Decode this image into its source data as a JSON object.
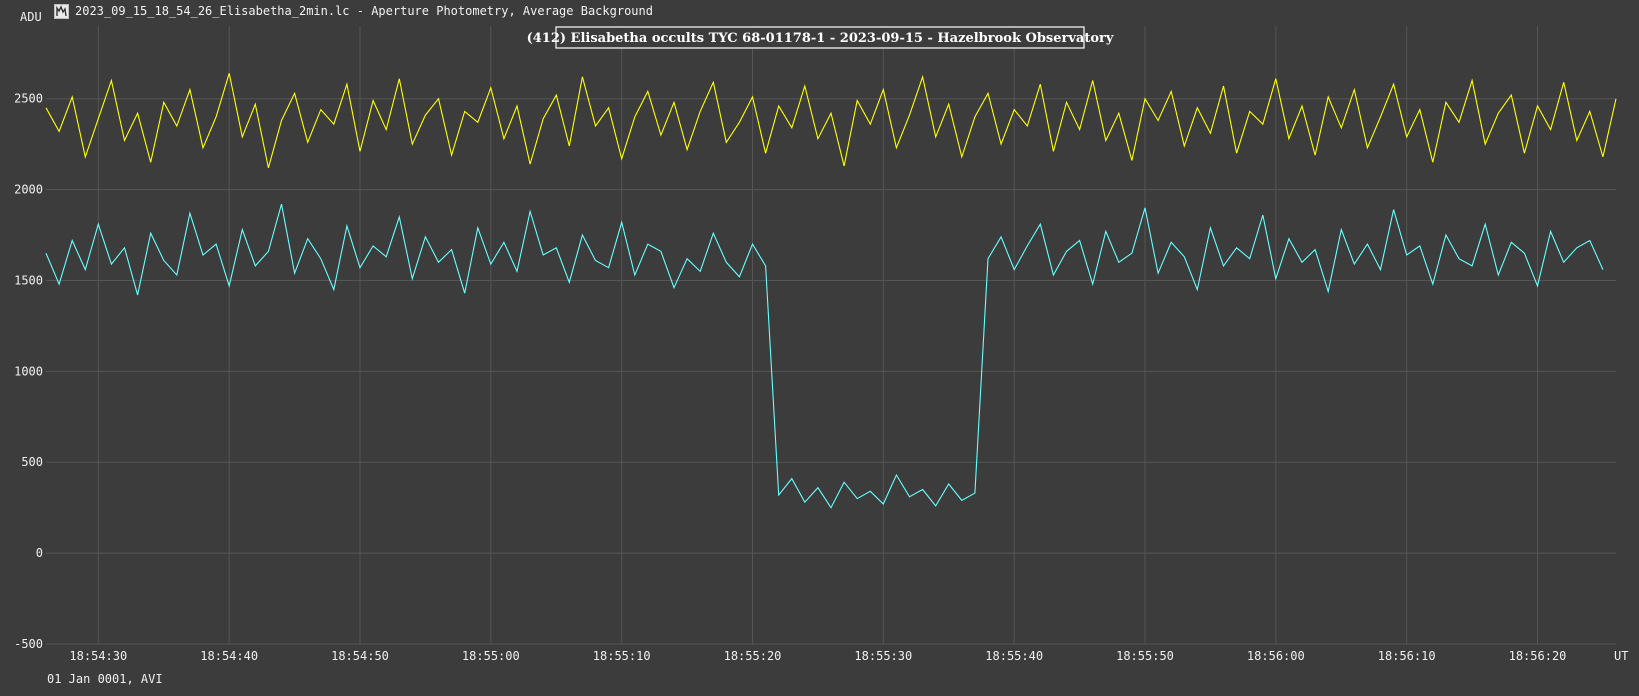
{
  "window": {
    "title": "2023_09_15_18_54_26_Elisabetha_2min.lc - Aperture Photometry, Average Background",
    "icon": "lightcurve-app-icon"
  },
  "footer": {
    "date_text": "01 Jan 0001, AVI"
  },
  "colors": {
    "background": "#3c3c3c",
    "grid": "#555555",
    "comparison": "#ffff00",
    "target": "#66ffff",
    "title_border": "#ffffff"
  },
  "chart_data": {
    "type": "line",
    "title": "(412) Elisabetha occults TYC 68-01178-1 - 2023-09-15 - Hazelbrook Observatory",
    "ylabel": "ADU",
    "xlabel": "UT",
    "ylim": [
      -500,
      2900
    ],
    "xlim_seconds_after_18_54_26": [
      0,
      120
    ],
    "y_ticks": [
      -500,
      0,
      500,
      1000,
      1500,
      2000,
      2500
    ],
    "y_tick_labels": [
      "-500",
      "0",
      "500",
      "1000",
      "1500",
      "2000",
      "2500"
    ],
    "x_ticks_seconds_after_18_54_26": [
      4,
      14,
      24,
      34,
      44,
      54,
      64,
      74,
      84,
      94,
      104,
      114
    ],
    "x_tick_labels": [
      "18:54:30",
      "18:54:40",
      "18:54:50",
      "18:55:00",
      "18:55:10",
      "18:55:20",
      "18:55:30",
      "18:55:40",
      "18:55:50",
      "18:56:00",
      "18:56:10",
      "18:56:20"
    ],
    "grid": true,
    "legend": "none",
    "series": [
      {
        "role": "comparison",
        "color": "#ffff00",
        "x_start": 0,
        "x_step": 1.0,
        "values": [
          2450,
          2320,
          2510,
          2180,
          2390,
          2600,
          2270,
          2420,
          2150,
          2480,
          2350,
          2550,
          2230,
          2400,
          2640,
          2290,
          2470,
          2120,
          2380,
          2530,
          2260,
          2440,
          2360,
          2580,
          2210,
          2490,
          2330,
          2610,
          2250,
          2410,
          2500,
          2190,
          2430,
          2370,
          2560,
          2280,
          2460,
          2140,
          2390,
          2520,
          2240,
          2620,
          2350,
          2450,
          2170,
          2400,
          2540,
          2300,
          2480,
          2220,
          2430,
          2590,
          2260,
          2370,
          2510,
          2200,
          2460,
          2340,
          2570,
          2280,
          2420,
          2130,
          2490,
          2360,
          2550,
          2230,
          2410,
          2620,
          2290,
          2470,
          2180,
          2400,
          2530,
          2250,
          2440,
          2350,
          2580,
          2210,
          2480,
          2330,
          2600,
          2270,
          2420,
          2160,
          2500,
          2380,
          2540,
          2240,
          2450,
          2310,
          2570,
          2200,
          2430,
          2360,
          2610,
          2280,
          2460,
          2190,
          2510,
          2340,
          2550,
          2230,
          2400,
          2580,
          2290,
          2440,
          2150,
          2480,
          2370,
          2600,
          2250,
          2420,
          2520,
          2200,
          2460,
          2330,
          2590,
          2270,
          2430,
          2180,
          2500
        ]
      },
      {
        "role": "target",
        "color": "#66ffff",
        "x_start": 0,
        "x_step": 1.0,
        "values": [
          1650,
          1480,
          1720,
          1560,
          1810,
          1590,
          1680,
          1420,
          1760,
          1610,
          1530,
          1870,
          1640,
          1700,
          1470,
          1780,
          1580,
          1660,
          1920,
          1540,
          1730,
          1620,
          1450,
          1800,
          1570,
          1690,
          1630,
          1850,
          1510,
          1740,
          1600,
          1670,
          1430,
          1790,
          1590,
          1710,
          1550,
          1880,
          1640,
          1680,
          1490,
          1750,
          1610,
          1570,
          1820,
          1530,
          1700,
          1660,
          1460,
          1620,
          1550,
          1760,
          1600,
          1520,
          1700,
          1580,
          320,
          410,
          280,
          360,
          250,
          390,
          300,
          340,
          270,
          430,
          310,
          350,
          260,
          380,
          290,
          330,
          1620,
          1740,
          1560,
          1690,
          1810,
          1530,
          1660,
          1720,
          1480,
          1770,
          1600,
          1650,
          1900,
          1540,
          1710,
          1630,
          1450,
          1790,
          1580,
          1680,
          1620,
          1860,
          1510,
          1730,
          1600,
          1670,
          1440,
          1780,
          1590,
          1700,
          1560,
          1890,
          1640,
          1690,
          1480,
          1750,
          1620,
          1580,
          1810,
          1530,
          1710,
          1650,
          1470,
          1770,
          1600,
          1680,
          1720,
          1560
        ]
      }
    ]
  }
}
